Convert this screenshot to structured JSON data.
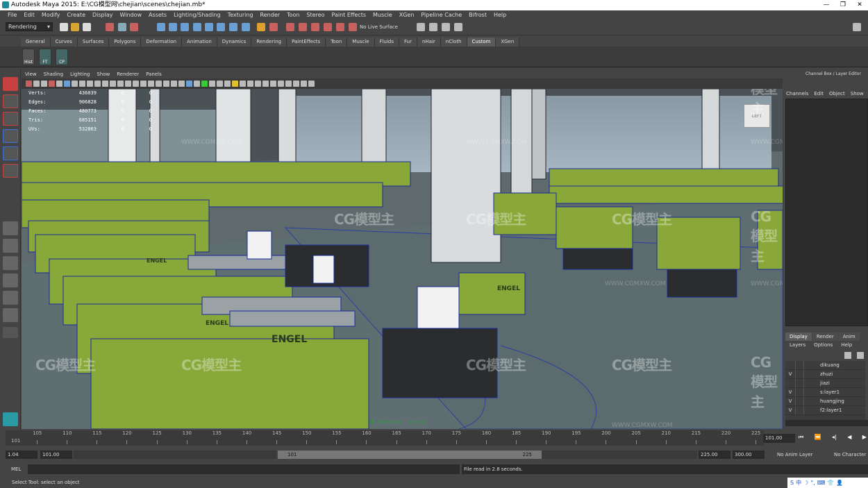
{
  "window": {
    "title": "Autodesk Maya 2015: E:\\CG模型网\\chejian\\scenes\\chejian.mb*",
    "controls": [
      "—",
      "❐",
      "✕"
    ]
  },
  "menubar": [
    "File",
    "Edit",
    "Modify",
    "Create",
    "Display",
    "Window",
    "Assets",
    "Lighting/Shading",
    "Texturing",
    "Render",
    "Toon",
    "Stereo",
    "Paint Effects",
    "Muscle",
    "XGen",
    "Pipeline Cache",
    "Bifrost",
    "Help"
  ],
  "statusline": {
    "mode": "Rendering",
    "live_surface": "No Live Surface"
  },
  "shelf": {
    "tabs": [
      "General",
      "Curves",
      "Surfaces",
      "Polygons",
      "Deformation",
      "Animation",
      "Dynamics",
      "Rendering",
      "PaintEffects",
      "Toon",
      "Muscle",
      "Fluids",
      "Fur",
      "nHair",
      "nCloth",
      "Custom",
      "XGen"
    ],
    "active_tab": "Custom",
    "buttons": [
      "Hist",
      "FT",
      "CP"
    ]
  },
  "panel": {
    "menus": [
      "View",
      "Shading",
      "Lighting",
      "Show",
      "Renderer",
      "Panels"
    ]
  },
  "hud": [
    {
      "label": "Verts:",
      "total": "436039",
      "sel": "0",
      "comp": "0"
    },
    {
      "label": "Edges:",
      "total": "906828",
      "sel": "0",
      "comp": "0"
    },
    {
      "label": "Faces:",
      "total": "480773",
      "sel": "0",
      "comp": "0"
    },
    {
      "label": "Tris:",
      "total": "685151",
      "sel": "0",
      "comp": "0"
    },
    {
      "label": "UVs:",
      "total": "532863",
      "sel": "0",
      "comp": "0"
    }
  ],
  "viewport": {
    "camera_label": "CB Yaw/Zoom - persp",
    "viewcube_label": "LEFT",
    "machine_brand": "ENGEL",
    "watermark_logo": "CG模型主",
    "watermark_url": "WWW.CGMXW.COM"
  },
  "channel_box": {
    "title": "Channel Box / Layer Editor",
    "menus": [
      "Channels",
      "Edit",
      "Object",
      "Show"
    ]
  },
  "layer_editor": {
    "tabs": [
      "Display",
      "Render",
      "Anim"
    ],
    "active_tab": "Display",
    "menus": [
      "Layers",
      "Options",
      "Help"
    ],
    "layers": [
      {
        "visible": "",
        "name": "dikuang"
      },
      {
        "visible": "V",
        "name": "zhuzi"
      },
      {
        "visible": "",
        "name": "jiazi"
      },
      {
        "visible": "V",
        "name": "s:layer1"
      },
      {
        "visible": "V",
        "name": "huangjing"
      },
      {
        "visible": "V",
        "name": "f2:layer1"
      }
    ]
  },
  "timeline": {
    "ticks": [
      "105",
      "110",
      "115",
      "120",
      "125",
      "130",
      "135",
      "140",
      "145",
      "150",
      "155",
      "160",
      "165",
      "170",
      "175",
      "180",
      "185",
      "190",
      "195",
      "200",
      "205",
      "210",
      "215",
      "220",
      "225"
    ],
    "start_marker": "101",
    "current_frame": "101.00"
  },
  "range": {
    "playback_step": "1.04",
    "start": "101.00",
    "slider_start": "101",
    "slider_end": "225",
    "end": "225.00",
    "anim_end": "300.00",
    "anim_layer": "No Anim Layer",
    "character_set": "No Character Set"
  },
  "command": {
    "mode": "MEL",
    "result": "File read in  2.8 seconds."
  },
  "help_line": "Select Tool: select an object",
  "tray": [
    "S",
    "中",
    "☽",
    "°,",
    "⌨",
    "👕",
    "👤"
  ]
}
